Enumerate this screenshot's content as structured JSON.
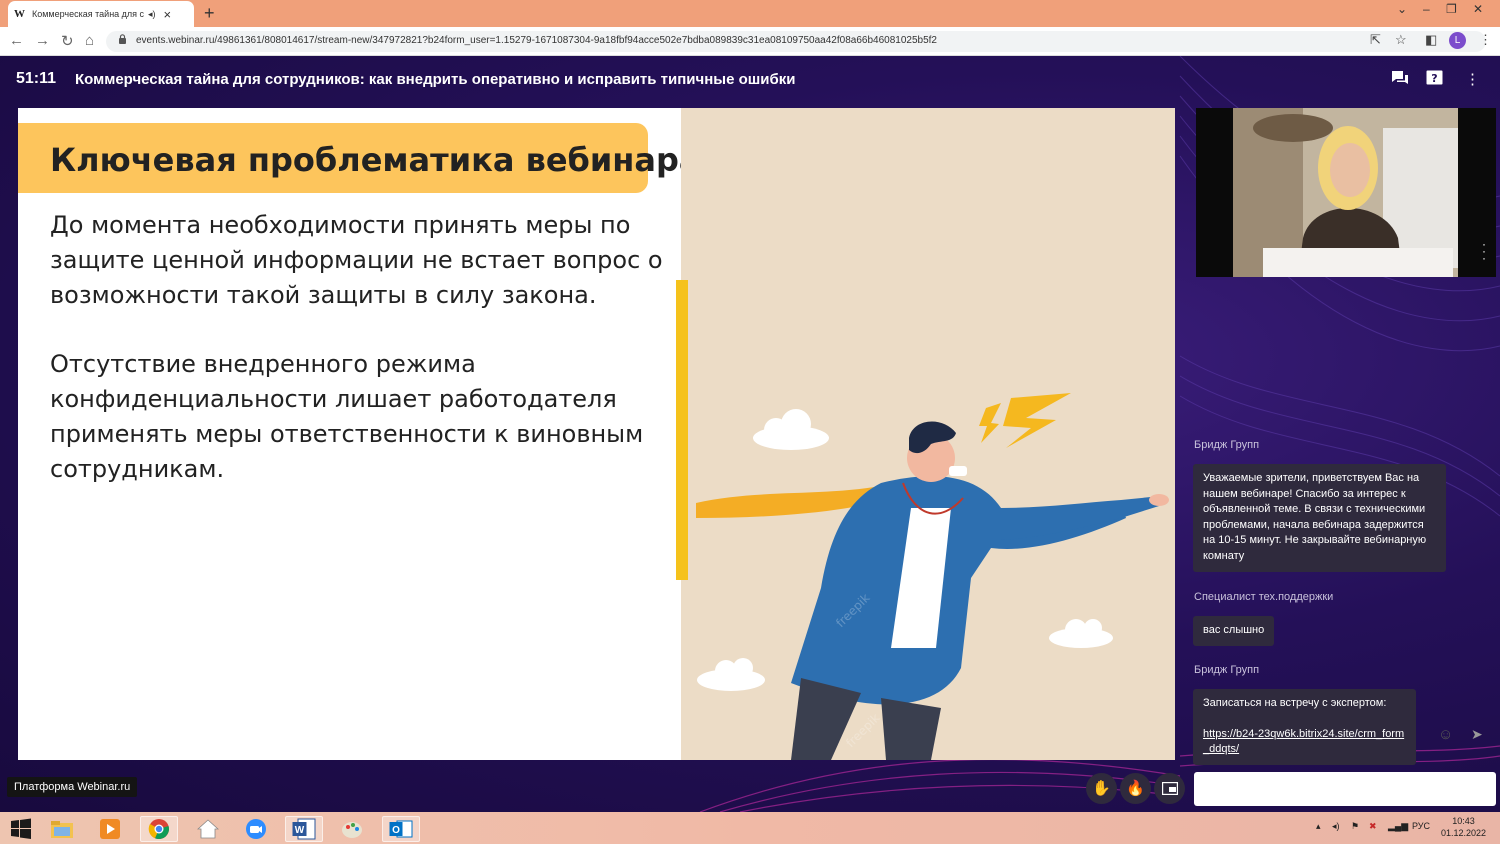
{
  "browser": {
    "tab_title": "Коммерческая тайна для сотрудников",
    "tab_logo": "W",
    "new_tab": "+",
    "url": "events.webinar.ru/49861361/808014617/stream-new/347972821?b24form_user=1.15279-1671087304-9a18fbf94acce502e7bdba089839c31ea08109750aa42f08a66b46081025b5f2",
    "profile_initial": "L"
  },
  "app": {
    "timer": "51:11",
    "title": "Коммерческая тайна для сотрудников: как внедрить оперативно и исправить типичные ошибки",
    "platform_label": "Платформа Webinar.ru"
  },
  "slide": {
    "heading": "Ключевая проблематика вебинара",
    "para1": "До момента необходимости принять меры по защите ценной информации не встает вопрос о возможности такой защиты в силу закона.",
    "para2": "Отсутствие внедренного режима конфиденциальности лишает работодателя применять меры ответственности к виновным сотрудникам.",
    "watermark": "freepik"
  },
  "chat": {
    "messages": [
      {
        "author": "Бридж Групп",
        "text": "Уважаемые зрители, приветствуем Вас на нашем вебинаре! Спасибо за интерес к объявленной теме. В связи с техническими проблемами, начала вебинара задержится на 10-15 минут. Не закрывайте вебинарную комнату"
      },
      {
        "author": "Специалист тех.поддержки",
        "text": "вас слышно"
      },
      {
        "author": "Бридж Групп",
        "text": "Записаться на встречу с экспертом:",
        "link": "https://b24-23qw6k.bitrix24.site/crm_form_ddqts/"
      }
    ],
    "input_placeholder": ""
  },
  "taskbar": {
    "language": "РУС",
    "time": "10:43",
    "date": "01.12.2022"
  },
  "colors": {
    "accent_yellow": "#fdc55c",
    "app_bg": "#241058",
    "bubble_bg": "#2f2a3d"
  }
}
